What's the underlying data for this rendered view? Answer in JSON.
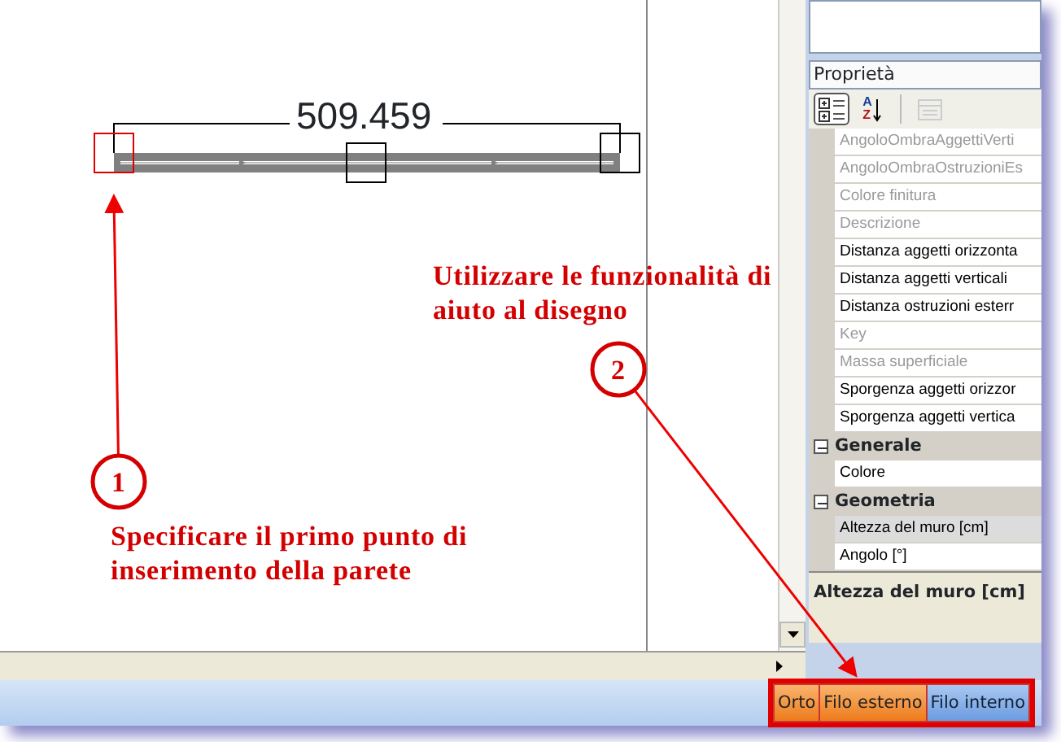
{
  "drawing": {
    "dimension": "509.459"
  },
  "properties_panel": {
    "title": "Proprietà",
    "toolbar": [
      {
        "kind": "categorized",
        "selected": true,
        "disabled": false
      },
      {
        "kind": "alphabetical",
        "selected": false,
        "disabled": false,
        "letters": [
          "A",
          "Z"
        ]
      },
      {
        "kind": "pages",
        "selected": false,
        "disabled": true
      }
    ],
    "rows": [
      {
        "kind": "property",
        "label": "AngoloOmbraAggettiVerti",
        "disabled": true,
        "selected": false
      },
      {
        "kind": "property",
        "label": "AngoloOmbraOstruzioniEs",
        "disabled": true,
        "selected": false
      },
      {
        "kind": "property",
        "label": "Colore finitura",
        "disabled": true,
        "selected": false
      },
      {
        "kind": "property",
        "label": "Descrizione",
        "disabled": true,
        "selected": false
      },
      {
        "kind": "property",
        "label": "Distanza aggetti orizzonta",
        "disabled": false,
        "selected": false
      },
      {
        "kind": "property",
        "label": "Distanza aggetti verticali",
        "disabled": false,
        "selected": false
      },
      {
        "kind": "property",
        "label": "Distanza ostruzioni esterr",
        "disabled": false,
        "selected": false
      },
      {
        "kind": "property",
        "label": "Key",
        "disabled": true,
        "selected": false
      },
      {
        "kind": "property",
        "label": "Massa superficiale",
        "disabled": true,
        "selected": false
      },
      {
        "kind": "property",
        "label": "Sporgenza aggetti orizzor",
        "disabled": false,
        "selected": false
      },
      {
        "kind": "property",
        "label": "Sporgenza aggetti vertica",
        "disabled": false,
        "selected": false
      },
      {
        "kind": "category",
        "label": "Generale",
        "expanded": true
      },
      {
        "kind": "property",
        "label": "Colore",
        "disabled": false,
        "selected": false
      },
      {
        "kind": "category",
        "label": "Geometria",
        "expanded": true
      },
      {
        "kind": "property",
        "label": "Altezza del muro [cm]",
        "disabled": false,
        "selected": true
      },
      {
        "kind": "property",
        "label": "Angolo [°]",
        "disabled": false,
        "selected": false
      }
    ],
    "description": "Altezza del muro [cm]"
  },
  "status_bar": {
    "toggles": [
      {
        "label": "Orto",
        "on": true
      },
      {
        "label": "Filo esterno",
        "on": true
      },
      {
        "label": "Filo interno",
        "on": false
      }
    ]
  },
  "annotations": [
    {
      "number": "1",
      "text": "Specificare il primo punto di inserimento della parete"
    },
    {
      "number": "2",
      "text": "Utilizzare le funzionalità di aiuto al disegno"
    }
  ]
}
